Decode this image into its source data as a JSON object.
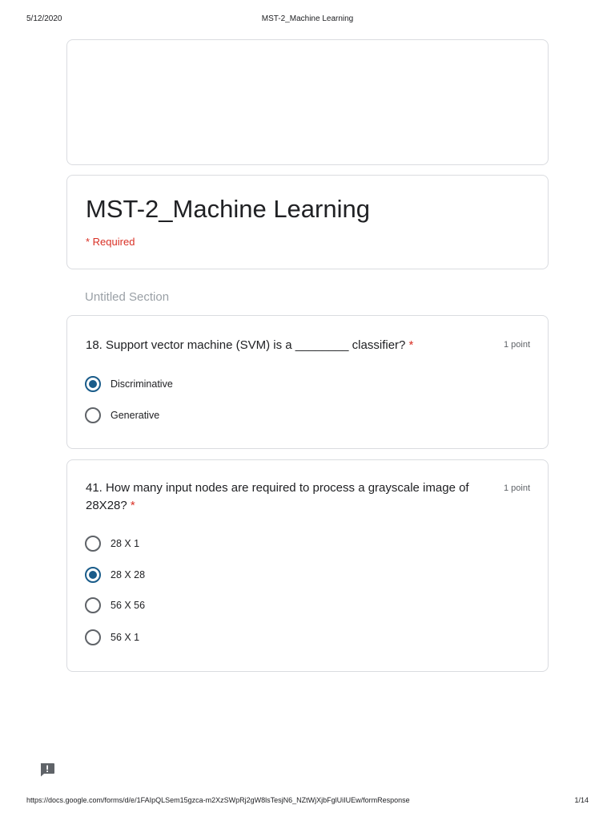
{
  "print_header": {
    "date": "5/12/2020",
    "title": "MST-2_Machine Learning"
  },
  "form": {
    "title": "MST-2_Machine Learning",
    "required_note": "* Required",
    "section_title": "Untitled Section"
  },
  "questions": [
    {
      "text": "18. Support vector machine (SVM) is a ________ classifier?",
      "required_mark": "*",
      "points": "1 point",
      "options": [
        {
          "label": "Discriminative",
          "selected": true
        },
        {
          "label": "Generative",
          "selected": false
        }
      ]
    },
    {
      "text": "41. How many input nodes are required to process a grayscale image of 28X28?",
      "required_mark": "*",
      "points": "1 point",
      "options": [
        {
          "label": "28 X 1",
          "selected": false
        },
        {
          "label": "28 X 28",
          "selected": true
        },
        {
          "label": "56 X 56",
          "selected": false
        },
        {
          "label": "56 X 1",
          "selected": false
        }
      ]
    }
  ],
  "print_footer": {
    "url": "https://docs.google.com/forms/d/e/1FAIpQLSem15gzca-m2XzSWpRj2gW8lsTesjN6_NZtWjXjbFglUiIUEw/formResponse",
    "page": "1/14"
  },
  "icons": {
    "feedback": "report-feedback-icon",
    "radio_checked_color": "#1a5c8a",
    "required_color": "#d93025"
  }
}
